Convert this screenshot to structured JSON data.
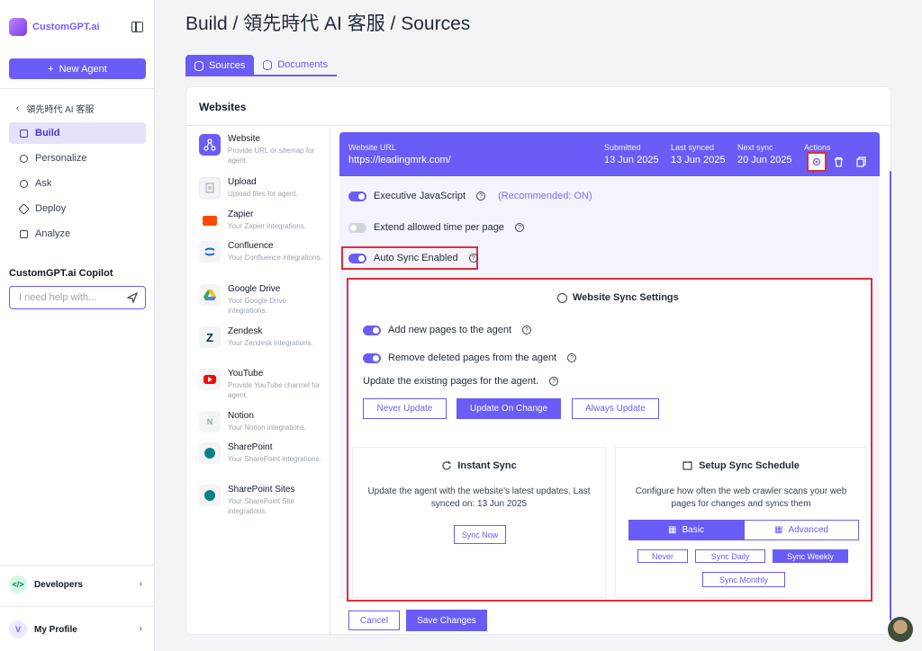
{
  "brand": {
    "name": "CustomGPT.ai"
  },
  "sidebar": {
    "new_agent": "New Agent",
    "back_label": "領先時代 AI 客服",
    "nav": [
      {
        "label": "Build",
        "icon": "tools-icon",
        "active": true
      },
      {
        "label": "Personalize",
        "icon": "palette-icon",
        "active": false
      },
      {
        "label": "Ask",
        "icon": "chat-icon",
        "active": false
      },
      {
        "label": "Deploy",
        "icon": "rocket-icon",
        "active": false
      },
      {
        "label": "Analyze",
        "icon": "chart-icon",
        "active": false
      }
    ],
    "copilot_title": "CustomGPT.ai Copilot",
    "copilot_placeholder": "I need help with...",
    "developers": "Developers",
    "profile": "My Profile",
    "profile_initial": "V"
  },
  "header": {
    "title": "Build / 領先時代 AI 客服 / Sources"
  },
  "tabs": [
    {
      "label": "Sources",
      "active": true
    },
    {
      "label": "Documents",
      "active": false
    }
  ],
  "card": {
    "title": "Websites"
  },
  "sources": [
    {
      "name": "Website",
      "desc": "Provide URL or sitemap for agent.",
      "icon": "sitemap-icon"
    },
    {
      "name": "Upload",
      "desc": "Upload files for agent.",
      "icon": "upload-icon"
    },
    {
      "name": "Zapier",
      "desc": "Your Zapier integrations.",
      "icon": "zapier-icon"
    },
    {
      "name": "Confluence",
      "desc": "Your Confluence integrations.",
      "icon": "confluence-icon"
    },
    {
      "name": "Google Drive",
      "desc": "Your Google Drive integrations.",
      "icon": "google-drive-icon"
    },
    {
      "name": "Zendesk",
      "desc": "Your Zendesk integrations.",
      "icon": "zendesk-icon"
    },
    {
      "name": "YouTube",
      "desc": "Provide YouTube channel for agent.",
      "icon": "youtube-icon"
    },
    {
      "name": "Notion",
      "desc": "Your Notion integrations.",
      "icon": "notion-icon"
    },
    {
      "name": "SharePoint",
      "desc": "Your SharePoint integrations.",
      "icon": "sharepoint-icon"
    },
    {
      "name": "SharePoint Sites",
      "desc": "Your SharePoint Site integrations.",
      "icon": "sharepoint-sites-icon"
    }
  ],
  "website": {
    "url_label": "Website URL",
    "url": "https://leadingmrk.com/",
    "submitted_label": "Submitted",
    "submitted": "13 Jun 2025",
    "last_synced_label": "Last synced",
    "last_synced": "13 Jun 2025",
    "next_sync_label": "Next sync",
    "next_sync": "20 Jun 2025",
    "actions_label": "Actions"
  },
  "settings": {
    "exec_js": "Executive JavaScript",
    "exec_js_note": "(Recommended: ON)",
    "extend_time": "Extend allowed time per page",
    "auto_sync": "Auto Sync Enabled"
  },
  "sync_settings": {
    "title": "Website Sync Settings",
    "add_new": "Add new pages to the agent",
    "remove_deleted": "Remove deleted pages from the agent",
    "update_existing": "Update the existing pages for the agent.",
    "update_options": [
      "Never Update",
      "Update On Change",
      "Always Update"
    ],
    "selected_update": "Update On Change"
  },
  "instant_sync": {
    "title": "Instant Sync",
    "desc": "Update the agent with the website's latest updates. Last synced on: 13 Jun 2025",
    "button": "Sync Now"
  },
  "schedule": {
    "title": "Setup Sync Schedule",
    "desc": "Configure how often the web crawler scans your web pages for changes and syncs them",
    "mode_basic": "Basic",
    "mode_advanced": "Advanced",
    "options": [
      "Never",
      "Sync Daily",
      "Sync Weekly",
      "Sync Monthly"
    ],
    "selected": "Sync Weekly"
  },
  "footer_buttons": {
    "cancel": "Cancel",
    "save": "Save Changes"
  },
  "colors": {
    "accent": "#6a5cf6",
    "highlight": "#dc2f3c"
  }
}
